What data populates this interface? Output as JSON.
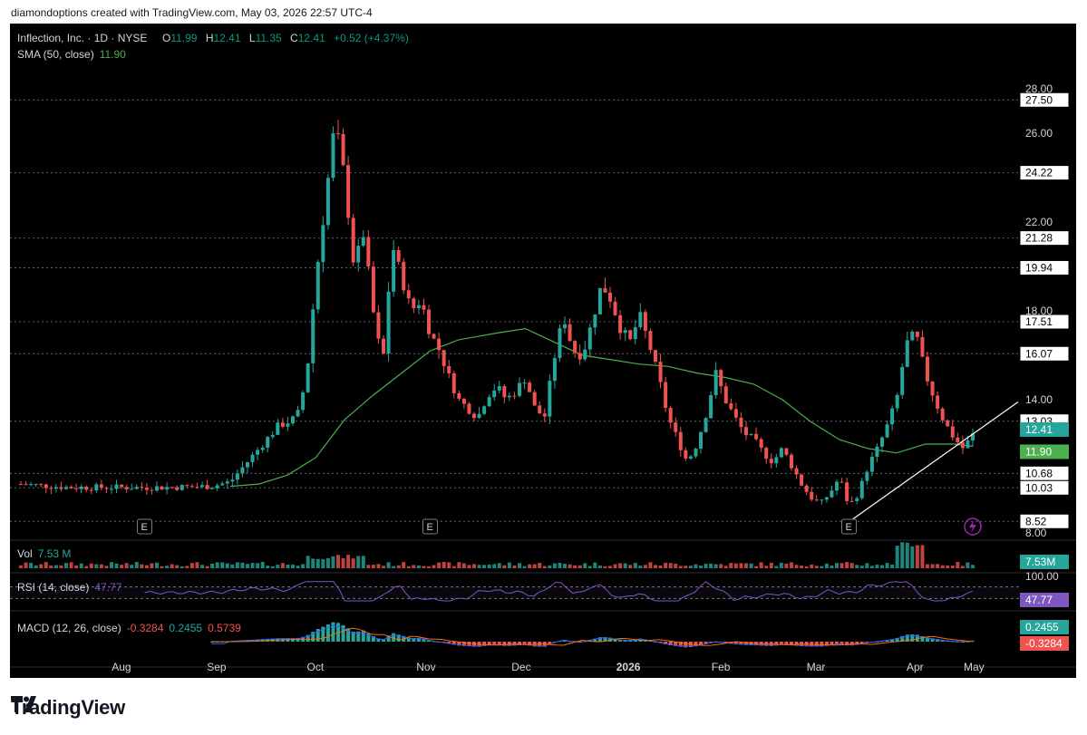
{
  "header": {
    "caption": "diamondoptions created with TradingView.com, May 03, 2026 22:57 UTC-4"
  },
  "legend": {
    "symbol": "Inflection, Inc. · 1D · NYSE",
    "o_label": "O",
    "o_value": "11.99",
    "h_label": "H",
    "h_value": "12.41",
    "l_label": "L",
    "l_value": "11.35",
    "c_label": "C",
    "c_value": "12.41",
    "change": "+0.52 (+4.37%)",
    "sma_label": "SMA (50, close)",
    "sma_value": "11.90",
    "vol_label": "Vol",
    "vol_value": "7.53 M",
    "rsi_label": "RSI (14, close)",
    "rsi_value": "47.77",
    "macd_label": "MACD (12, 26, close)",
    "macd_values": [
      "-0.3284",
      "0.2455",
      "0.5739"
    ]
  },
  "brand": {
    "name": "TradingView"
  },
  "colors": {
    "up": "#26a69a",
    "down": "#ef5350",
    "legend_up": "#089981",
    "sma": "#4caf50",
    "rsi": "#7e57c2",
    "macd": "#2962ff",
    "signal": "#ff6d00",
    "background": "#000000",
    "trendline": "#ffffff",
    "axis_text": "#d1d4dc"
  },
  "chart_data": {
    "type": "candlestick",
    "title": "Inflection, Inc. · 1D · NYSE",
    "ylim": [
      8,
      28
    ],
    "y_ticks": [
      "28.00",
      "26.00",
      "22.00",
      "18.00",
      "14.00",
      "8.00"
    ],
    "x_ticks": [
      "Aug",
      "Sep",
      "Oct",
      "Nov",
      "Dec",
      "2026",
      "Feb",
      "Mar",
      "Apr",
      "May"
    ],
    "level_lines": [
      {
        "value": 27.5,
        "label": "27.50"
      },
      {
        "value": 24.22,
        "label": "24.22"
      },
      {
        "value": 21.28,
        "label": "21.28"
      },
      {
        "value": 19.94,
        "label": "19.94"
      },
      {
        "value": 17.51,
        "label": "17.51"
      },
      {
        "value": 16.07,
        "label": "16.07"
      },
      {
        "value": 13.03,
        "label": "13.03"
      },
      {
        "value": 10.68,
        "label": "10.68"
      },
      {
        "value": 10.03,
        "label": "10.03"
      },
      {
        "value": 8.52,
        "label": "8.52"
      }
    ],
    "last_price": {
      "value": 12.41,
      "label": "12.41"
    },
    "sma_last": {
      "value": 11.9,
      "label": "11.90"
    },
    "earnings_markers": [
      {
        "x": 0.13,
        "label": "E"
      },
      {
        "x": 0.43,
        "label": "E"
      },
      {
        "x": 0.87,
        "label": "E"
      }
    ],
    "trendline": {
      "from": {
        "x": 0.87,
        "y": 8.5
      },
      "to": {
        "x": 1.0,
        "y": 13.0
      }
    },
    "sma_anchors": [
      [
        0.22,
        10.1
      ],
      [
        0.25,
        10.2
      ],
      [
        0.28,
        10.6
      ],
      [
        0.31,
        11.4
      ],
      [
        0.34,
        13.1
      ],
      [
        0.37,
        14.2
      ],
      [
        0.4,
        15.2
      ],
      [
        0.43,
        16.2
      ],
      [
        0.46,
        16.7
      ],
      [
        0.5,
        17.0
      ],
      [
        0.53,
        17.2
      ],
      [
        0.56,
        16.6
      ],
      [
        0.59,
        16.0
      ],
      [
        0.62,
        15.8
      ],
      [
        0.65,
        15.6
      ],
      [
        0.68,
        15.5
      ],
      [
        0.71,
        15.2
      ],
      [
        0.74,
        15.0
      ],
      [
        0.77,
        14.7
      ],
      [
        0.8,
        14.0
      ],
      [
        0.83,
        13.0
      ],
      [
        0.86,
        12.2
      ],
      [
        0.89,
        11.8
      ],
      [
        0.92,
        11.6
      ],
      [
        0.95,
        12.0
      ],
      [
        0.98,
        12.0
      ],
      [
        1.0,
        11.9
      ]
    ],
    "price_anchors": [
      [
        0.0,
        10.2
      ],
      [
        0.05,
        10.05
      ],
      [
        0.1,
        10.05
      ],
      [
        0.15,
        10.05
      ],
      [
        0.2,
        10.1
      ],
      [
        0.22,
        10.3
      ],
      [
        0.25,
        11.8
      ],
      [
        0.27,
        12.8
      ],
      [
        0.29,
        13.2
      ],
      [
        0.3,
        15.0
      ],
      [
        0.31,
        19.5
      ],
      [
        0.32,
        23.0
      ],
      [
        0.33,
        26.5
      ],
      [
        0.34,
        24.0
      ],
      [
        0.35,
        20.0
      ],
      [
        0.36,
        21.5
      ],
      [
        0.37,
        18.0
      ],
      [
        0.38,
        15.5
      ],
      [
        0.39,
        21.0
      ],
      [
        0.4,
        19.5
      ],
      [
        0.41,
        18.0
      ],
      [
        0.42,
        18.5
      ],
      [
        0.43,
        17.0
      ],
      [
        0.44,
        16.2
      ],
      [
        0.45,
        15.0
      ],
      [
        0.46,
        14.0
      ],
      [
        0.47,
        13.6
      ],
      [
        0.48,
        13.2
      ],
      [
        0.49,
        14.2
      ],
      [
        0.5,
        14.6
      ],
      [
        0.51,
        14.0
      ],
      [
        0.52,
        14.4
      ],
      [
        0.53,
        15.0
      ],
      [
        0.54,
        13.6
      ],
      [
        0.55,
        13.2
      ],
      [
        0.56,
        15.8
      ],
      [
        0.57,
        17.8
      ],
      [
        0.58,
        16.2
      ],
      [
        0.59,
        16.0
      ],
      [
        0.6,
        17.5
      ],
      [
        0.61,
        19.2
      ],
      [
        0.62,
        18.5
      ],
      [
        0.63,
        17.2
      ],
      [
        0.64,
        16.6
      ],
      [
        0.65,
        17.8
      ],
      [
        0.66,
        16.5
      ],
      [
        0.67,
        15.0
      ],
      [
        0.68,
        13.2
      ],
      [
        0.69,
        12.2
      ],
      [
        0.7,
        11.2
      ],
      [
        0.71,
        12.0
      ],
      [
        0.72,
        13.4
      ],
      [
        0.73,
        15.2
      ],
      [
        0.74,
        14.0
      ],
      [
        0.75,
        13.2
      ],
      [
        0.76,
        12.5
      ],
      [
        0.77,
        12.2
      ],
      [
        0.78,
        11.6
      ],
      [
        0.79,
        11.2
      ],
      [
        0.8,
        11.8
      ],
      [
        0.81,
        11.0
      ],
      [
        0.82,
        10.2
      ],
      [
        0.83,
        9.6
      ],
      [
        0.84,
        9.3
      ],
      [
        0.85,
        9.8
      ],
      [
        0.86,
        10.5
      ],
      [
        0.87,
        9.2
      ],
      [
        0.88,
        9.8
      ],
      [
        0.89,
        11.0
      ],
      [
        0.9,
        11.8
      ],
      [
        0.91,
        12.8
      ],
      [
        0.92,
        14.0
      ],
      [
        0.93,
        16.5
      ],
      [
        0.94,
        17.0
      ],
      [
        0.95,
        15.2
      ],
      [
        0.96,
        14.0
      ],
      [
        0.97,
        13.0
      ],
      [
        0.98,
        12.3
      ],
      [
        0.99,
        11.8
      ],
      [
        1.0,
        12.41
      ]
    ],
    "rsi": {
      "label": "RSI (14, close)",
      "value": 47.77,
      "value_label": "47.77",
      "ylim": [
        0,
        100
      ],
      "top_label": "100.00",
      "bands": [
        70,
        30
      ]
    },
    "volume": {
      "label": "Vol",
      "value_label": "7.53M"
    },
    "macd": {
      "label": "MACD (12, 26, close)",
      "values": [
        -0.3284,
        0.2455,
        0.5739
      ],
      "value_labels": [
        "0.2455",
        "-0.3284"
      ]
    }
  }
}
